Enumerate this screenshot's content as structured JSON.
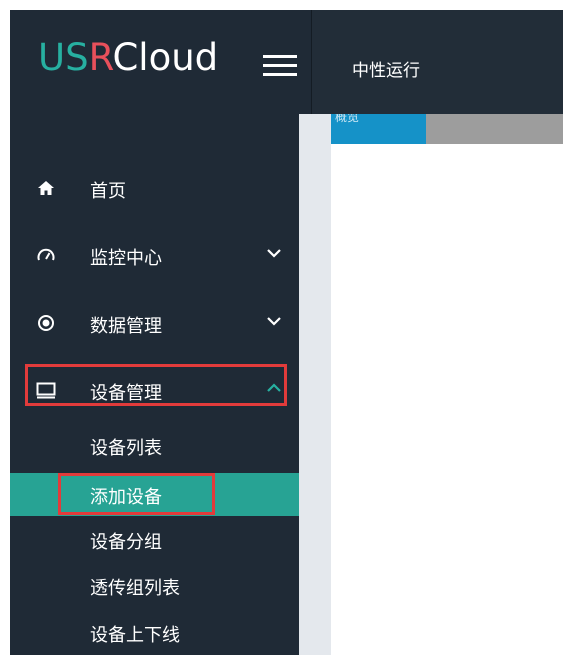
{
  "header": {
    "logo": {
      "part1": "US",
      "part2": "R",
      "part3": "Cloud"
    },
    "menu_icon": "hamburger-icon",
    "page_title": "中性运行"
  },
  "tab": {
    "active_label": "概览"
  },
  "sidebar": {
    "items": [
      {
        "label": "首页",
        "icon": "home-icon"
      },
      {
        "label": "监控中心",
        "icon": "dashboard-icon",
        "chevron": "chevron-down-icon"
      },
      {
        "label": "数据管理",
        "icon": "radio-icon",
        "chevron": "chevron-down-icon"
      },
      {
        "label": "设备管理",
        "icon": "monitor-icon",
        "chevron": "chevron-up-icon",
        "expanded": true
      }
    ],
    "sub_items": [
      {
        "label": "设备列表"
      },
      {
        "label": "添加设备",
        "active": true
      },
      {
        "label": "设备分组"
      },
      {
        "label": "透传组列表"
      },
      {
        "label": "设备上下线"
      }
    ]
  },
  "colors": {
    "sidebar_bg": "#1f2a36",
    "active_sub_bg": "#27a394",
    "highlight_border": "#e23b3b",
    "tab_active": "#1592c8"
  }
}
